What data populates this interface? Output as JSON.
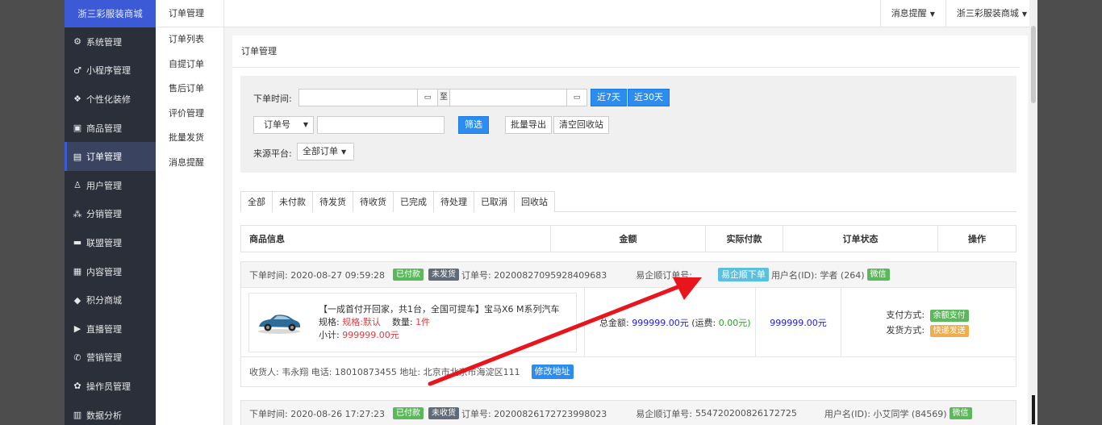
{
  "sidebar": {
    "brand": "浙三彩服装商城",
    "items": [
      {
        "label": "系统管理",
        "icon": "⚙",
        "name": "gear-icon"
      },
      {
        "label": "小程序管理",
        "icon": "♂",
        "name": "mini-program-icon"
      },
      {
        "label": "个性化装修",
        "icon": "❖",
        "name": "decorate-icon"
      },
      {
        "label": "商品管理",
        "icon": "▣",
        "name": "goods-icon"
      },
      {
        "label": "订单管理",
        "icon": "▤",
        "name": "order-icon"
      },
      {
        "label": "用户管理",
        "icon": "♙",
        "name": "user-icon"
      },
      {
        "label": "分销管理",
        "icon": "⁂",
        "name": "distribution-icon"
      },
      {
        "label": "联盟管理",
        "icon": "▬",
        "name": "alliance-icon"
      },
      {
        "label": "内容管理",
        "icon": "▦",
        "name": "content-icon"
      },
      {
        "label": "积分商城",
        "icon": "◆",
        "name": "points-icon"
      },
      {
        "label": "直播管理",
        "icon": "▶",
        "name": "live-icon"
      },
      {
        "label": "营销管理",
        "icon": "✆",
        "name": "marketing-icon"
      },
      {
        "label": "操作员管理",
        "icon": "✿",
        "name": "operator-icon"
      },
      {
        "label": "数据分析",
        "icon": "▥",
        "name": "chart-icon"
      }
    ]
  },
  "subnav": {
    "title": "订单管理",
    "items": [
      "订单列表",
      "自提订单",
      "售后订单",
      "评价管理",
      "批量发货",
      "消息提醒"
    ]
  },
  "topbar": {
    "messages": "消息提醒",
    "shop": "浙三彩服装商城"
  },
  "page": {
    "title": "订单管理"
  },
  "filter": {
    "time_label": "下单时间:",
    "to": "至",
    "btn_7": "近7天",
    "btn_30": "近30天",
    "select_value": "订单号",
    "search_btn": "筛选",
    "export_btn": "批量导出",
    "clear_btn": "清空回收站",
    "source_label": "来源平台:",
    "source_value": "全部订单"
  },
  "tabs": [
    "全部",
    "未付款",
    "待发货",
    "待收货",
    "已完成",
    "待处理",
    "已取消",
    "回收站"
  ],
  "table": {
    "headers": [
      "商品信息",
      "金额",
      "实际付款",
      "订单状态",
      "操作"
    ]
  },
  "orders": [
    {
      "time": "下单时间: 2020-08-27 09:59:28",
      "paid_badge": "已付款",
      "ship_badge": "未发货",
      "order_no": "订单号: 20200827095928409683",
      "yqs_label": "易企顺订单号:",
      "yqs_no": "",
      "yqs_button": "易企顺下单",
      "user": "用户名(ID): 学者 (264)",
      "channel": "微信",
      "product_title": "【一成首付开回家，共1台，全国可提车】宝马X6 M系列汽车",
      "spec_label": "规格:",
      "spec_value": "规格:默认",
      "qty_label": "数量:",
      "qty_value": "1件",
      "subtotal_label": "小计:",
      "subtotal_value": "999999.00元",
      "total_label": "总金额:",
      "total_value": "999999.00元",
      "freight_label": "(运费:",
      "freight_value": "0.00元)",
      "paid_amount": "999999.00元",
      "pay_label": "支付方式:",
      "pay_value": "余额支付",
      "ship_label": "发货方式:",
      "ship_value": "快递发送",
      "receiver": "收货人: 韦永翔  电话: 18010873455  地址: 北京市北京市海淀区111",
      "edit_addr": "修改地址"
    },
    {
      "time": "下单时间: 2020-08-26 17:27:23",
      "paid_badge": "已付款",
      "ship_badge": "未收货",
      "order_no": "订单号: 20200826172723998023",
      "yqs_label": "易企顺订单号:",
      "yqs_no": "554720200826172725",
      "user": "用户名(ID): 小艾同学 (84569)",
      "channel": "微信"
    }
  ],
  "colors": {
    "primary": "#2d8cf0",
    "sidebar": "#2b2f3a",
    "brand": "#3c5ad6",
    "green": "#5cb85c",
    "gray": "#5f6b76",
    "info": "#5bc0de",
    "orange": "#f0ad4e",
    "arrow": "#e8161c"
  }
}
